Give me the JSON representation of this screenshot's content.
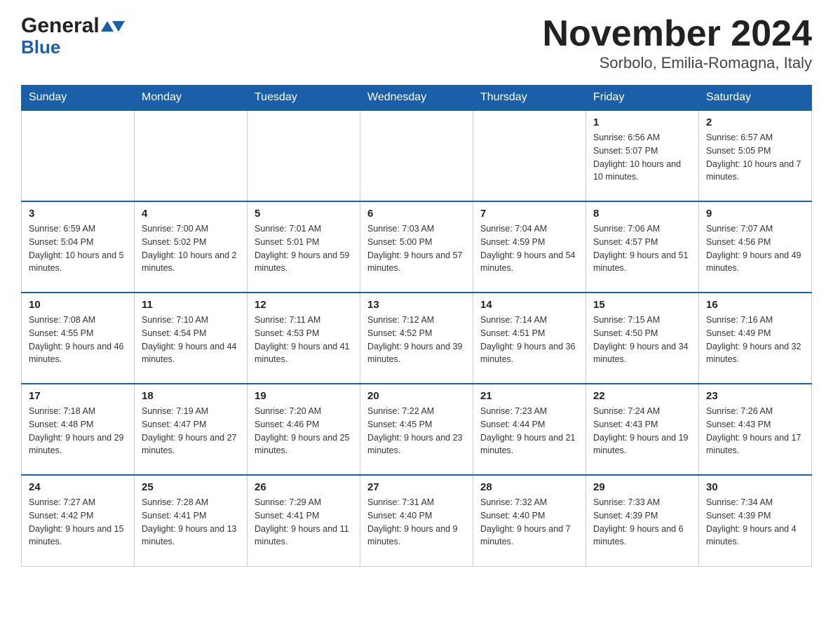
{
  "logo": {
    "general": "General",
    "blue": "Blue"
  },
  "title": "November 2024",
  "subtitle": "Sorbolo, Emilia-Romagna, Italy",
  "weekdays": [
    "Sunday",
    "Monday",
    "Tuesday",
    "Wednesday",
    "Thursday",
    "Friday",
    "Saturday"
  ],
  "weeks": [
    [
      {
        "day": "",
        "info": ""
      },
      {
        "day": "",
        "info": ""
      },
      {
        "day": "",
        "info": ""
      },
      {
        "day": "",
        "info": ""
      },
      {
        "day": "",
        "info": ""
      },
      {
        "day": "1",
        "info": "Sunrise: 6:56 AM\nSunset: 5:07 PM\nDaylight: 10 hours and 10 minutes."
      },
      {
        "day": "2",
        "info": "Sunrise: 6:57 AM\nSunset: 5:05 PM\nDaylight: 10 hours and 7 minutes."
      }
    ],
    [
      {
        "day": "3",
        "info": "Sunrise: 6:59 AM\nSunset: 5:04 PM\nDaylight: 10 hours and 5 minutes."
      },
      {
        "day": "4",
        "info": "Sunrise: 7:00 AM\nSunset: 5:02 PM\nDaylight: 10 hours and 2 minutes."
      },
      {
        "day": "5",
        "info": "Sunrise: 7:01 AM\nSunset: 5:01 PM\nDaylight: 9 hours and 59 minutes."
      },
      {
        "day": "6",
        "info": "Sunrise: 7:03 AM\nSunset: 5:00 PM\nDaylight: 9 hours and 57 minutes."
      },
      {
        "day": "7",
        "info": "Sunrise: 7:04 AM\nSunset: 4:59 PM\nDaylight: 9 hours and 54 minutes."
      },
      {
        "day": "8",
        "info": "Sunrise: 7:06 AM\nSunset: 4:57 PM\nDaylight: 9 hours and 51 minutes."
      },
      {
        "day": "9",
        "info": "Sunrise: 7:07 AM\nSunset: 4:56 PM\nDaylight: 9 hours and 49 minutes."
      }
    ],
    [
      {
        "day": "10",
        "info": "Sunrise: 7:08 AM\nSunset: 4:55 PM\nDaylight: 9 hours and 46 minutes."
      },
      {
        "day": "11",
        "info": "Sunrise: 7:10 AM\nSunset: 4:54 PM\nDaylight: 9 hours and 44 minutes."
      },
      {
        "day": "12",
        "info": "Sunrise: 7:11 AM\nSunset: 4:53 PM\nDaylight: 9 hours and 41 minutes."
      },
      {
        "day": "13",
        "info": "Sunrise: 7:12 AM\nSunset: 4:52 PM\nDaylight: 9 hours and 39 minutes."
      },
      {
        "day": "14",
        "info": "Sunrise: 7:14 AM\nSunset: 4:51 PM\nDaylight: 9 hours and 36 minutes."
      },
      {
        "day": "15",
        "info": "Sunrise: 7:15 AM\nSunset: 4:50 PM\nDaylight: 9 hours and 34 minutes."
      },
      {
        "day": "16",
        "info": "Sunrise: 7:16 AM\nSunset: 4:49 PM\nDaylight: 9 hours and 32 minutes."
      }
    ],
    [
      {
        "day": "17",
        "info": "Sunrise: 7:18 AM\nSunset: 4:48 PM\nDaylight: 9 hours and 29 minutes."
      },
      {
        "day": "18",
        "info": "Sunrise: 7:19 AM\nSunset: 4:47 PM\nDaylight: 9 hours and 27 minutes."
      },
      {
        "day": "19",
        "info": "Sunrise: 7:20 AM\nSunset: 4:46 PM\nDaylight: 9 hours and 25 minutes."
      },
      {
        "day": "20",
        "info": "Sunrise: 7:22 AM\nSunset: 4:45 PM\nDaylight: 9 hours and 23 minutes."
      },
      {
        "day": "21",
        "info": "Sunrise: 7:23 AM\nSunset: 4:44 PM\nDaylight: 9 hours and 21 minutes."
      },
      {
        "day": "22",
        "info": "Sunrise: 7:24 AM\nSunset: 4:43 PM\nDaylight: 9 hours and 19 minutes."
      },
      {
        "day": "23",
        "info": "Sunrise: 7:26 AM\nSunset: 4:43 PM\nDaylight: 9 hours and 17 minutes."
      }
    ],
    [
      {
        "day": "24",
        "info": "Sunrise: 7:27 AM\nSunset: 4:42 PM\nDaylight: 9 hours and 15 minutes."
      },
      {
        "day": "25",
        "info": "Sunrise: 7:28 AM\nSunset: 4:41 PM\nDaylight: 9 hours and 13 minutes."
      },
      {
        "day": "26",
        "info": "Sunrise: 7:29 AM\nSunset: 4:41 PM\nDaylight: 9 hours and 11 minutes."
      },
      {
        "day": "27",
        "info": "Sunrise: 7:31 AM\nSunset: 4:40 PM\nDaylight: 9 hours and 9 minutes."
      },
      {
        "day": "28",
        "info": "Sunrise: 7:32 AM\nSunset: 4:40 PM\nDaylight: 9 hours and 7 minutes."
      },
      {
        "day": "29",
        "info": "Sunrise: 7:33 AM\nSunset: 4:39 PM\nDaylight: 9 hours and 6 minutes."
      },
      {
        "day": "30",
        "info": "Sunrise: 7:34 AM\nSunset: 4:39 PM\nDaylight: 9 hours and 4 minutes."
      }
    ]
  ]
}
